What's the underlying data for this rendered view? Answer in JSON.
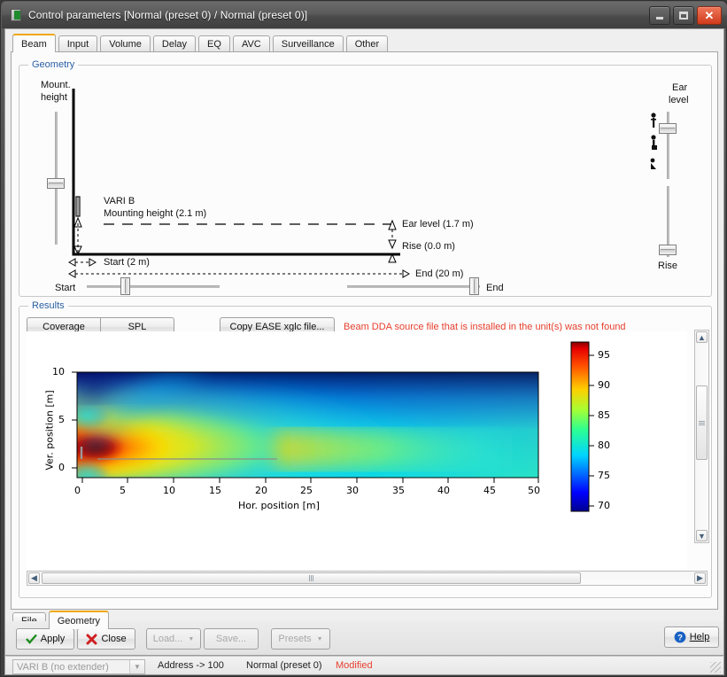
{
  "window": {
    "title": "Control parameters [Normal (preset 0) / Normal (preset 0)]",
    "icon": "speaker-icon",
    "buttons": {
      "minimize": "–",
      "maximize": "□",
      "close": "✕"
    }
  },
  "tabs": [
    {
      "label": "Beam",
      "active": true
    },
    {
      "label": "Input",
      "active": false
    },
    {
      "label": "Volume",
      "active": false
    },
    {
      "label": "Delay",
      "active": false
    },
    {
      "label": "EQ",
      "active": false
    },
    {
      "label": "AVC",
      "active": false
    },
    {
      "label": "Surveillance",
      "active": false
    },
    {
      "label": "Other",
      "active": false
    }
  ],
  "geometry": {
    "group_title": "Geometry",
    "mount_height_slider_label_line1": "Mount.",
    "mount_height_slider_label_line2": "height",
    "ear_level_slider_label_line1": "Ear",
    "ear_level_slider_label_line2": "level",
    "rise_slider_label": "Rise",
    "start_slider_label": "Start",
    "end_slider_label": "End",
    "device_name": "VARI B",
    "mounting_height": "Mounting height (2.1 m)",
    "ear_level": "Ear level (1.7 m)",
    "rise": "Rise (0.0 m)",
    "start": "Start (2 m)",
    "end": "End (20 m)",
    "person_icons": [
      "standing-person-icon",
      "sitting-person-icon",
      "lying-person-icon"
    ]
  },
  "results": {
    "group_title": "Results",
    "coverage_button": "Coverage",
    "spl_button": "SPL",
    "copy_ease_button": "Copy EASE xglc file...",
    "warning": "Beam DDA source file that is installed in the unit(s) was not found"
  },
  "chart_data": {
    "type": "heatmap",
    "title": "",
    "xlabel": "Hor. position [m]",
    "ylabel": "Ver. position [m]",
    "xlim": [
      -1.5,
      50
    ],
    "ylim": [
      -2.2,
      10
    ],
    "xticks": [
      0,
      5,
      10,
      15,
      20,
      25,
      30,
      35,
      40,
      45,
      50
    ],
    "yticks": [
      0,
      5,
      10
    ],
    "colorbar": {
      "label": "",
      "min": 70,
      "max": 98,
      "ticks": [
        70,
        75,
        80,
        85,
        90,
        95
      ],
      "colormap": "jet"
    },
    "overlays": [
      {
        "name": "loudspeaker-marker",
        "x": 0,
        "y": 1.2,
        "color": "#808080"
      },
      {
        "name": "audience-plane-line",
        "x_start": 2,
        "x_end": 20,
        "y": 0,
        "color": "#808080"
      }
    ],
    "description": "SPL coverage map: hot (95-98 dB) lobe along the audience plane from 0 to about 10 m, cooling to 70-80 dB at far field and high elevation."
  },
  "bottom_tabs": [
    {
      "label": "File",
      "active": false
    },
    {
      "label": "Geometry",
      "active": true
    }
  ],
  "footer": {
    "apply": "Apply",
    "close": "Close",
    "load": "Load...",
    "save": "Save...",
    "presets": "Presets",
    "help": "Help"
  },
  "statusbar": {
    "device_select": "VARI B (no extender)",
    "address": "Address -> 100",
    "preset": "Normal (preset 0)",
    "modified": "Modified"
  },
  "colors": {
    "accent": "#f0a818",
    "group_title": "#2a5fa5",
    "warning": "#e8402f",
    "modified": "#e8402f"
  }
}
